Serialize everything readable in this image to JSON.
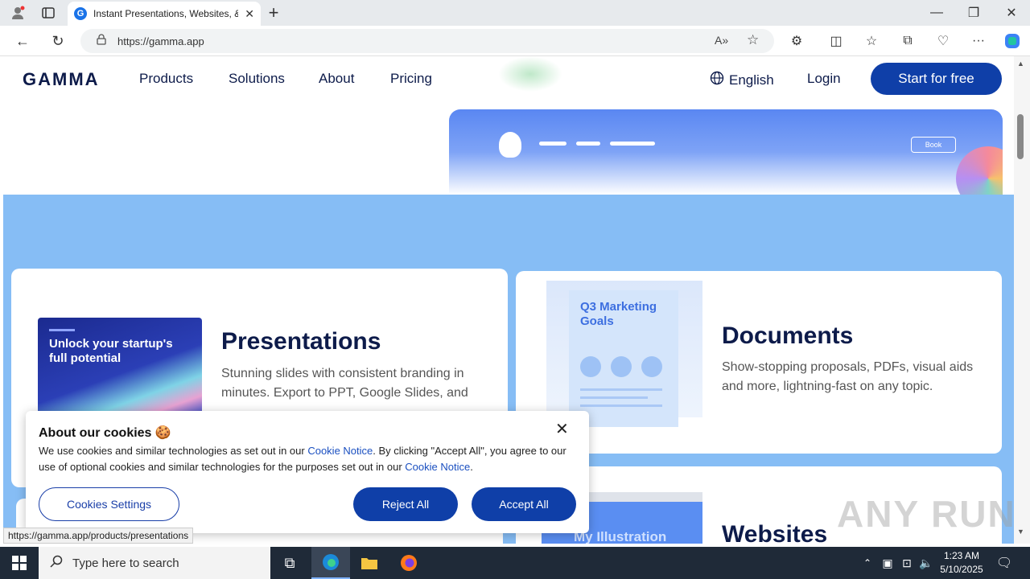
{
  "browser": {
    "tab_title": "Instant Presentations, Websites, &",
    "tab_favicon": "G",
    "url": "https://gamma.app",
    "status_url": "https://gamma.app/products/presentations"
  },
  "nav": {
    "logo": "GAMMA",
    "links": [
      "Products",
      "Solutions",
      "About",
      "Pricing"
    ],
    "language": "English",
    "login": "Login",
    "cta": "Start for free"
  },
  "hero_preview": {
    "button": "Book"
  },
  "cards": {
    "presentations": {
      "thumb_text": "Unlock your startup's full potential",
      "title": "Presentations",
      "description": "Stunning slides with consistent branding in minutes. Export to PPT, Google Slides, and"
    },
    "documents": {
      "thumb_text": "Q3 Marketing Goals",
      "title": "Documents",
      "description": "Show-stopping proposals, PDFs, visual aids and more, lightning-fast on any topic."
    },
    "websites": {
      "thumb_text": "My Illustration",
      "title": "Websites"
    }
  },
  "cookie": {
    "title": "About our cookies 🍪",
    "text_1": "We use cookies and similar technologies as set out in our ",
    "link_1": "Cookie Notice",
    "text_2": ". By clicking \"Accept All\", you agree to our use of optional cookies and similar technologies for the purposes set out in our ",
    "link_2": "Cookie Notice",
    "text_3": ".",
    "settings_button": "Cookies Settings",
    "reject_button": "Reject All",
    "accept_button": "Accept All"
  },
  "taskbar": {
    "search_placeholder": "Type here to search",
    "time": "1:23 AM",
    "date": "5/10/2025"
  },
  "watermark": "ANY RUN"
}
